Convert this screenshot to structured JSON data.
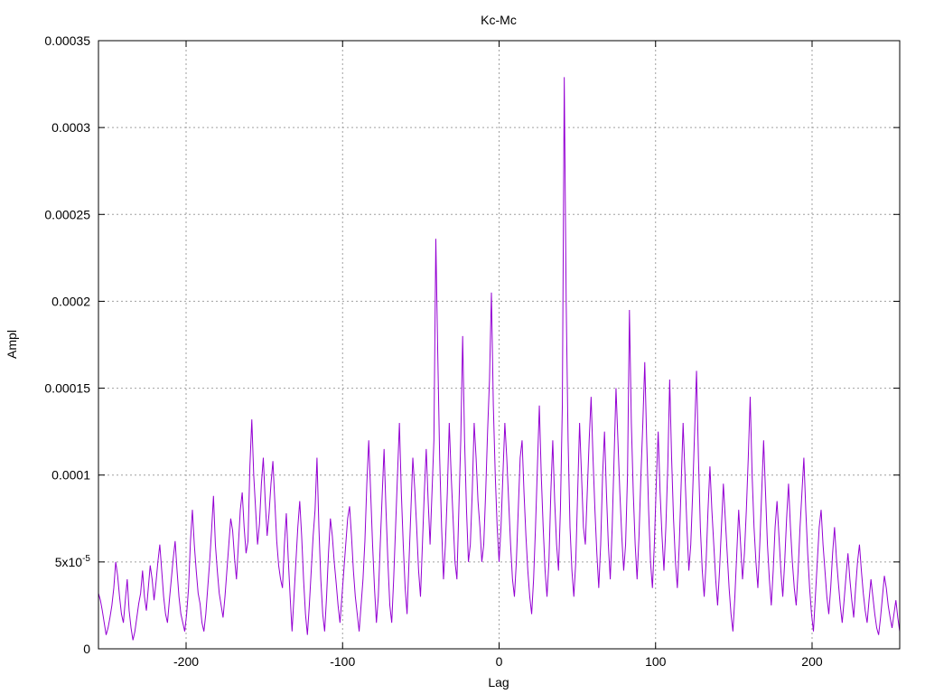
{
  "chart_data": {
    "type": "line",
    "title": "Kc-Mc",
    "xlabel": "Lag",
    "ylabel": "Ampl",
    "xlim": [
      -256,
      256
    ],
    "ylim": [
      0,
      0.00035
    ],
    "x_ticks": [
      -200,
      -100,
      0,
      100,
      200
    ],
    "x_tick_labels": [
      "-200",
      "-100",
      "0",
      "100",
      "200"
    ],
    "y_ticks": [
      0,
      5e-05,
      0.0001,
      0.00015,
      0.0002,
      0.00025,
      0.0003,
      0.00035
    ],
    "y_tick_labels": [
      "0",
      "5x10-5",
      "0.0001",
      "0.00015",
      "0.0002",
      "0.00025",
      "0.0003",
      "0.00035"
    ],
    "grid": true,
    "series": [
      {
        "color": "#9400d3",
        "x_start": -256,
        "x_step": 1,
        "values": [
          3.2e-05,
          2.8e-05,
          2.2e-05,
          1.5e-05,
          8e-06,
          1.2e-05,
          1.8e-05,
          2.5e-05,
          3.5e-05,
          5e-05,
          4.2e-05,
          3e-05,
          2e-05,
          1.5e-05,
          2.8e-05,
          4e-05,
          2.2e-05,
          1.2e-05,
          5e-06,
          1e-05,
          1.8e-05,
          2.6e-05,
          3.2e-05,
          4.5e-05,
          3e-05,
          2.2e-05,
          3.5e-05,
          4.8e-05,
          4e-05,
          2.8e-05,
          3.8e-05,
          5e-05,
          6e-05,
          4.5e-05,
          3e-05,
          2e-05,
          1.5e-05,
          2.8e-05,
          4e-05,
          5.2e-05,
          6.2e-05,
          4.5e-05,
          3e-05,
          2e-05,
          1.5e-05,
          1e-05,
          2e-05,
          3.5e-05,
          6.2e-05,
          8e-05,
          6e-05,
          4.5e-05,
          3.2e-05,
          2.6e-05,
          1.5e-05,
          1e-05,
          2e-05,
          3.5e-05,
          5e-05,
          6.8e-05,
          8.8e-05,
          6e-05,
          4.5e-05,
          3.2e-05,
          2.5e-05,
          1.8e-05,
          3e-05,
          4.5e-05,
          6e-05,
          7.5e-05,
          6.8e-05,
          5.2e-05,
          4e-05,
          6e-05,
          8e-05,
          9e-05,
          7e-05,
          5.5e-05,
          6.2e-05,
          0.000105,
          0.000132,
          0.0001,
          8e-05,
          6e-05,
          7.2e-05,
          9.5e-05,
          0.00011,
          8.5e-05,
          6.5e-05,
          7.8e-05,
          9.5e-05,
          0.000108,
          8.5e-05,
          6.2e-05,
          4.8e-05,
          4e-05,
          3.5e-05,
          6e-05,
          7.8e-05,
          5.2e-05,
          3e-05,
          1e-05,
          3e-05,
          5e-05,
          7e-05,
          8.5e-05,
          6.5e-05,
          4e-05,
          2e-05,
          8e-06,
          2.5e-05,
          4.5e-05,
          6.5e-05,
          8e-05,
          0.00011,
          7e-05,
          4e-05,
          2e-05,
          1e-05,
          3e-05,
          5.5e-05,
          7.5e-05,
          6.5e-05,
          5e-05,
          3.8e-05,
          2.5e-05,
          1.5e-05,
          3e-05,
          4.5e-05,
          6e-05,
          7.5e-05,
          8.2e-05,
          6.5e-05,
          4.5e-05,
          3e-05,
          2e-05,
          1e-05,
          2.5e-05,
          4e-05,
          6.2e-05,
          9.5e-05,
          0.00012,
          9e-05,
          6e-05,
          3.5e-05,
          1.5e-05,
          3e-05,
          6e-05,
          8.8e-05,
          0.000115,
          8e-05,
          5e-05,
          2.5e-05,
          1.5e-05,
          4e-05,
          7e-05,
          0.0001,
          0.00013,
          9e-05,
          6e-05,
          3.5e-05,
          2e-05,
          5e-05,
          8e-05,
          0.00011,
          9.2e-05,
          7e-05,
          4.5e-05,
          3e-05,
          6e-05,
          9e-05,
          0.000115,
          8.5e-05,
          6e-05,
          9e-05,
          0.00012,
          0.000236,
          0.00017,
          0.00011,
          7e-05,
          4e-05,
          6e-05,
          9e-05,
          0.00013,
          0.0001,
          7.5e-05,
          5e-05,
          4e-05,
          8e-05,
          0.00012,
          0.00018,
          0.00012,
          8e-05,
          5e-05,
          6e-05,
          9e-05,
          0.00013,
          0.00011,
          8.5e-05,
          7e-05,
          5e-05,
          6e-05,
          9e-05,
          0.000125,
          0.000155,
          0.000205,
          0.00014,
          0.0001,
          7e-05,
          5e-05,
          7e-05,
          0.0001,
          0.00013,
          0.00011,
          8.5e-05,
          6e-05,
          4e-05,
          3e-05,
          5e-05,
          8e-05,
          0.00011,
          0.00012,
          9e-05,
          6.5e-05,
          4.5e-05,
          3e-05,
          2e-05,
          4e-05,
          7e-05,
          0.000105,
          0.00014,
          0.0001,
          7e-05,
          4.5e-05,
          3e-05,
          5e-05,
          9e-05,
          0.00012,
          8.5e-05,
          6e-05,
          4.5e-05,
          8e-05,
          0.00014,
          0.000329,
          0.0002,
          0.00012,
          7e-05,
          4.5e-05,
          3e-05,
          5e-05,
          9e-05,
          0.00013,
          0.0001,
          7e-05,
          6e-05,
          9e-05,
          0.00012,
          0.000145,
          0.00011,
          8e-05,
          5.5e-05,
          3.5e-05,
          6e-05,
          0.0001,
          0.000125,
          9e-05,
          6e-05,
          4e-05,
          7e-05,
          0.00011,
          0.00015,
          0.00012,
          9e-05,
          6.5e-05,
          4.5e-05,
          6e-05,
          0.0001,
          0.000195,
          0.00013,
          9e-05,
          6e-05,
          4e-05,
          6.5e-05,
          0.0001,
          0.00013,
          0.000165,
          0.00012,
          8e-05,
          5e-05,
          3.5e-05,
          6e-05,
          9.5e-05,
          0.000125,
          9e-05,
          6.5e-05,
          4.5e-05,
          7e-05,
          0.000105,
          0.000155,
          0.00011,
          7.5e-05,
          5e-05,
          3.5e-05,
          6e-05,
          9.5e-05,
          0.00013,
          0.0001,
          7e-05,
          4.5e-05,
          6e-05,
          9e-05,
          0.000125,
          0.00016,
          0.00011,
          7e-05,
          4.5e-05,
          3e-05,
          5e-05,
          8e-05,
          0.000105,
          8e-05,
          6e-05,
          4e-05,
          2.5e-05,
          4.5e-05,
          7e-05,
          9.5e-05,
          7.5e-05,
          5.5e-05,
          3.5e-05,
          2e-05,
          1e-05,
          3e-05,
          5.5e-05,
          8e-05,
          6e-05,
          4e-05,
          5.5e-05,
          8e-05,
          0.00011,
          0.000145,
          0.0001,
          7e-05,
          5e-05,
          3.5e-05,
          6e-05,
          9e-05,
          0.00012,
          9e-05,
          6e-05,
          4e-05,
          2.5e-05,
          4.5e-05,
          7e-05,
          8.5e-05,
          6.5e-05,
          4.5e-05,
          3e-05,
          5e-05,
          7.5e-05,
          9.5e-05,
          7e-05,
          5e-05,
          3.5e-05,
          2.5e-05,
          4.5e-05,
          7e-05,
          9e-05,
          0.00011,
          8e-05,
          5.5e-05,
          3.5e-05,
          2e-05,
          1e-05,
          3e-05,
          5e-05,
          7e-05,
          8e-05,
          6e-05,
          4.5e-05,
          3e-05,
          2e-05,
          3.5e-05,
          5.5e-05,
          7e-05,
          5.2e-05,
          3.8e-05,
          2.5e-05,
          1.5e-05,
          2.8e-05,
          4.2e-05,
          5.5e-05,
          4e-05,
          2.8e-05,
          1.8e-05,
          3.5e-05,
          5e-05,
          6e-05,
          4.5e-05,
          3.2e-05,
          2.2e-05,
          1.5e-05,
          2.8e-05,
          4e-05,
          3e-05,
          2e-05,
          1.2e-05,
          8e-06,
          1.8e-05,
          3e-05,
          4.2e-05,
          3.5e-05,
          2.5e-05,
          1.8e-05,
          1.2e-05,
          2e-05,
          2.8e-05,
          1.8e-05,
          1e-05
        ]
      }
    ]
  }
}
